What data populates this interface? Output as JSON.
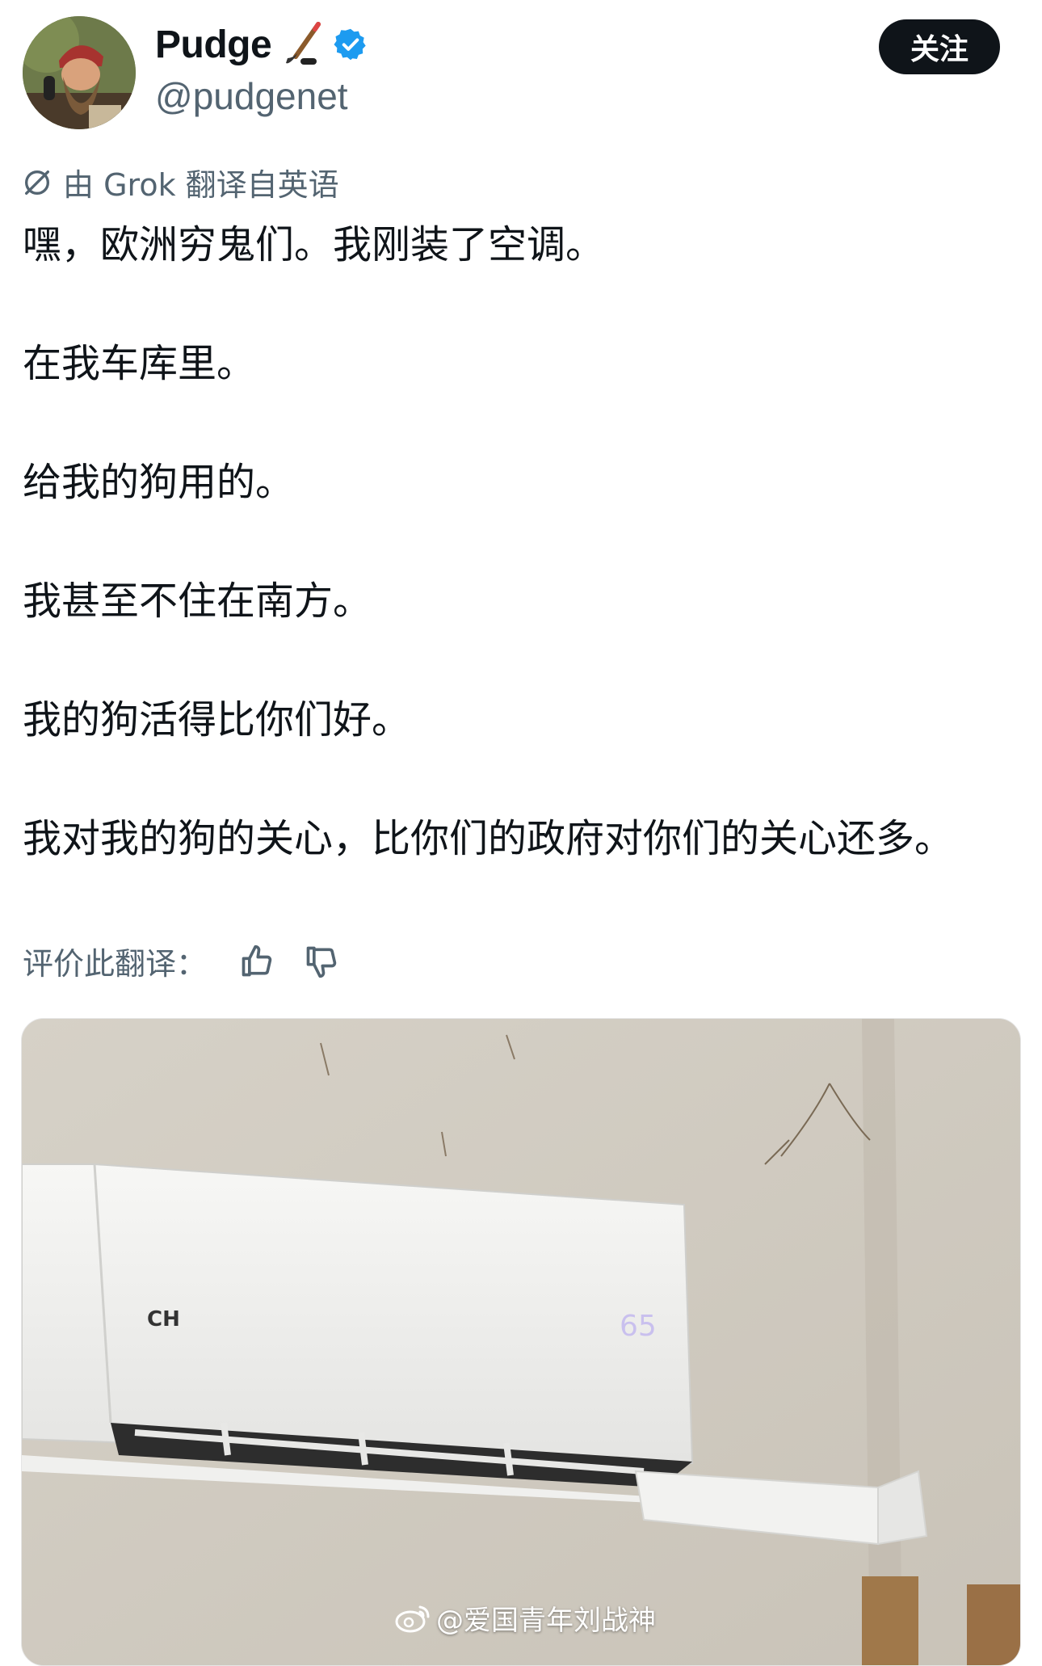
{
  "author": {
    "display_name": "Pudge",
    "name_emoji": "hockey-stick-icon",
    "verified": true,
    "handle": "@pudgenet",
    "follow_label": "关注"
  },
  "translation": {
    "note": "由 Grok 翻译自英语",
    "icon": "translate-slash-icon",
    "rate_label": "评价此翻译："
  },
  "tweet": {
    "paragraphs": [
      "嘿，欧洲穷鬼们。我刚装了空调。",
      "在我车库里。",
      "给我的狗用的。",
      "我甚至不住在南方。",
      "我的狗活得比你们好。",
      "我对我的狗的关心，比你们的政府对你们的关心还多。"
    ]
  },
  "photo": {
    "ac_brand": "CH",
    "ac_display": "65",
    "watermark": "@爱国青年刘战神",
    "watermark_icon": "weibo-icon"
  },
  "colors": {
    "text": "#0f1419",
    "secondary": "#536471",
    "verified_blue": "#1d9bf0",
    "button_bg": "#0f1419"
  }
}
